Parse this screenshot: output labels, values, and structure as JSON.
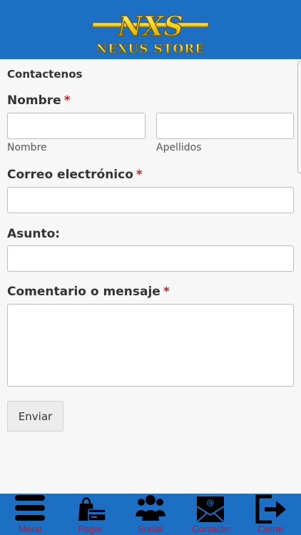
{
  "header": {
    "logo_mark": "NXS",
    "logo_text": "NEXUS STORE"
  },
  "form": {
    "section_title": "Contactenos",
    "required_marker": "*",
    "name_label": "Nombre",
    "first_name_caption": "Nombre",
    "last_name_caption": "Apellidos",
    "email_label": "Correo electrónico",
    "subject_label": "Asunto:",
    "comment_label": "Comentario o mensaje",
    "first_name_value": "",
    "last_name_value": "",
    "email_value": "",
    "subject_value": "",
    "comment_value": "",
    "submit_label": "Enviar"
  },
  "tabbar": {
    "items": [
      {
        "label": "Menu",
        "icon": "hamburger-menu-icon"
      },
      {
        "label": "Pagar",
        "icon": "shopping-bag-card-icon"
      },
      {
        "label": "Social",
        "icon": "people-group-icon"
      },
      {
        "label": "Contacto",
        "icon": "email-envelope-icon"
      },
      {
        "label": "Cerrar",
        "icon": "logout-exit-icon"
      }
    ]
  },
  "colors": {
    "header_bg": "#1d6fc4",
    "tab_label": "#c8102e",
    "required": "#c0262c",
    "logo_gold": "#f2d21b"
  }
}
